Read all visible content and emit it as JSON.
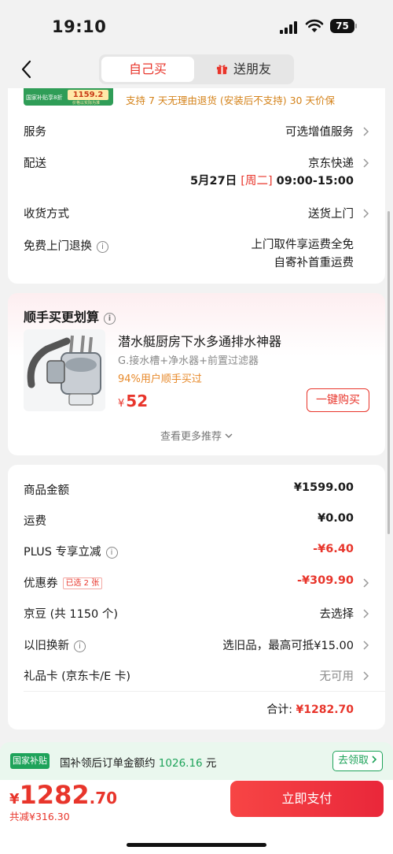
{
  "status_bar": {
    "time": "19:10",
    "battery": "75"
  },
  "nav": {
    "tab_self": "自己买",
    "tab_gift": "送朋友"
  },
  "banner": {
    "img_line1": "国家补贴享8折",
    "img_price": "1159.2",
    "img_line2": "价格以实际为准",
    "promo": "支持 7 天无理由退货 (安装后不支持)   30 天价保"
  },
  "service": {
    "service_label": "服务",
    "service_value": "可选增值服务",
    "delivery_label": "配送",
    "delivery_value": "京东快递",
    "delivery_date": "5月27日 ",
    "delivery_week": "[周二]",
    "delivery_slot": " 09:00-15:00",
    "receive_label": "收货方式",
    "receive_value": "送货上门",
    "return_label": "免费上门退换",
    "return_line1": "上门取件享运费全免",
    "return_line2": "自寄补首重运费"
  },
  "recommend": {
    "title": "顺手买更划算",
    "product_name": "潜水艇厨房下水多通排水神器",
    "product_spec": "G.接水槽+净水器+前置过滤器",
    "product_rate": "94%用户顺手买过",
    "currency": "¥",
    "price": "52",
    "buy_label": "一键购买",
    "more_label": "查看更多推荐"
  },
  "summary": {
    "goods_label": "商品金额",
    "goods_value": "¥1599.00",
    "freight_label": "运费",
    "freight_value": "¥0.00",
    "plus_label": "PLUS 专享立减",
    "plus_value": "-¥6.40",
    "coupon_label": "优惠券",
    "coupon_tag": "已选 2 张",
    "coupon_value": "-¥309.90",
    "jd_bean_label": "京豆 (共 1150 个)",
    "jd_bean_value": "去选择",
    "tradein_label": "以旧换新",
    "tradein_value": "选旧品，最高可抵¥15.00",
    "giftcard_label": "礼品卡 (京东卡/E 卡)",
    "giftcard_value": "无可用",
    "total_label": "合计: ",
    "total_value": "¥1282.70"
  },
  "subsidy": {
    "tag": "国家补贴",
    "text_prefix": "国补领后订单金额约 ",
    "amount": "1026.16",
    "text_suffix": " 元",
    "claim_label": "去领取"
  },
  "bottom_bar": {
    "currency": "¥",
    "price_int": "1282",
    "price_dec": ".70",
    "saved": "共减¥316.30",
    "pay_label": "立即支付"
  },
  "colors": {
    "accent": "#e8352b",
    "green": "#1ea35a",
    "promo_orange": "#d48219"
  }
}
